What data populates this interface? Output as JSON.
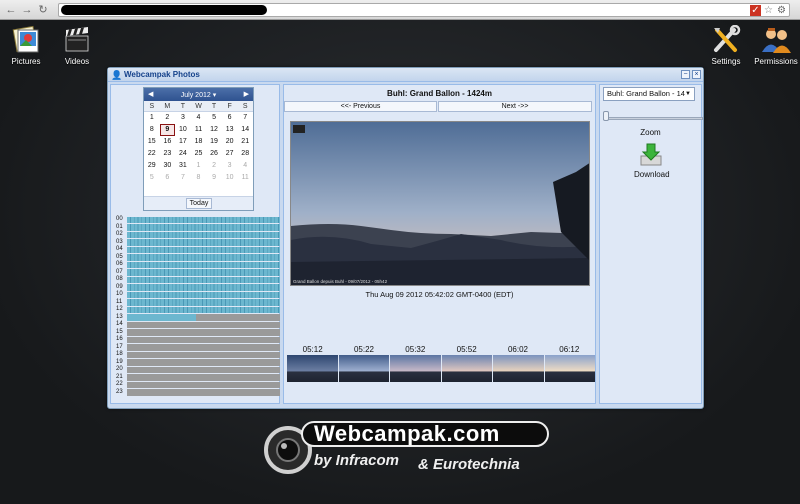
{
  "browser": {
    "back_icon": "back-arrow-icon",
    "forward_icon": "forward-arrow-icon",
    "reload_icon": "reload-icon"
  },
  "desktop": {
    "left_icons": [
      {
        "label": "Pictures",
        "icon": "pictures-icon"
      },
      {
        "label": "Videos",
        "icon": "clapperboard-icon"
      }
    ],
    "right_icons": [
      {
        "label": "Settings",
        "icon": "tools-icon"
      },
      {
        "label": "Permissions",
        "icon": "users-icon"
      }
    ]
  },
  "window": {
    "title": "Webcampak Photos",
    "calendar": {
      "month": "July 2012",
      "days_of_week": [
        "S",
        "M",
        "T",
        "W",
        "T",
        "F",
        "S"
      ],
      "weeks": [
        [
          "1",
          "2",
          "3",
          "4",
          "5",
          "6",
          "7"
        ],
        [
          "8",
          "9",
          "10",
          "11",
          "12",
          "13",
          "14"
        ],
        [
          "15",
          "16",
          "17",
          "18",
          "19",
          "20",
          "21"
        ],
        [
          "22",
          "23",
          "24",
          "25",
          "26",
          "27",
          "28"
        ],
        [
          "29",
          "30",
          "31",
          "1",
          "2",
          "3",
          "4"
        ],
        [
          "5",
          "6",
          "7",
          "8",
          "9",
          "10",
          "11"
        ]
      ],
      "selected_day": "9",
      "today_label": "Today"
    },
    "hours": {
      "labels": [
        "00",
        "01",
        "02",
        "03",
        "04",
        "05",
        "06",
        "07",
        "08",
        "09",
        "10",
        "11",
        "12",
        "13",
        "14",
        "15",
        "16",
        "17",
        "18",
        "19",
        "20",
        "21",
        "22",
        "23"
      ],
      "available_through": 12,
      "partial_hour": 13,
      "partial_fraction": 0.45
    },
    "photo": {
      "title": "Buhl: Grand Ballon - 1424m",
      "prev_label": "<<- Previous",
      "next_label": "Next ->>",
      "timestamp": "Thu Aug 09 2012 05:42:02 GMT-0400 (EDT)",
      "watermark": "Grand Ballon depuis Buhl - 09/07/2012 - 05h42"
    },
    "timeline": {
      "times": [
        "05:12",
        "05:22",
        "05:32",
        "05:52",
        "06:02",
        "06:12"
      ]
    },
    "right": {
      "camera_select": "Buhl: Grand Ballon - 14",
      "zoom_label": "Zoom",
      "zoom_level": 0,
      "download_label": "Download"
    }
  },
  "logo": {
    "brand": "Webcampak.com",
    "by": "by Infracom",
    "partner": "& Eurotechnia"
  },
  "colors": {
    "window_bg": "#c9d9ef",
    "title_text": "#15428b",
    "hour_on": "#6cb7cf",
    "hour_off": "#9a9a9a"
  }
}
